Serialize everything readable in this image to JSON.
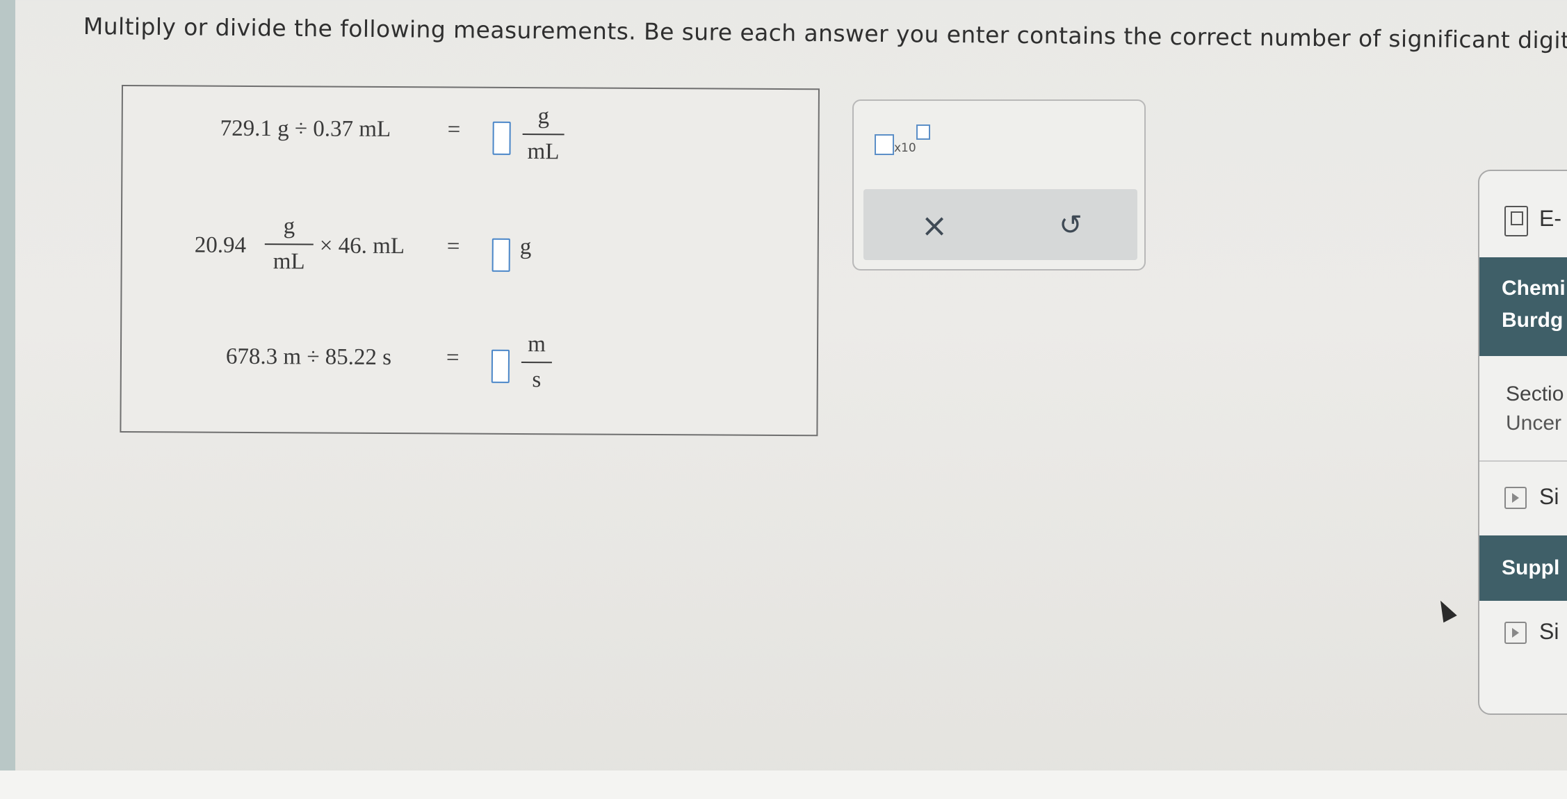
{
  "instructions": "Multiply or divide the following measurements. Be sure each answer you enter contains the correct number of significant digits.",
  "problems": [
    {
      "lhs": "729.1 g ÷ 0.37 mL",
      "equals": "=",
      "unit_num": "g",
      "unit_den": "mL"
    },
    {
      "lhs_value": "20.94",
      "lhs_num": "g",
      "lhs_den": "mL",
      "lhs_rest": "× 46. mL",
      "equals": "=",
      "unit": "g"
    },
    {
      "lhs": "678.3 m ÷ 85.22 s",
      "equals": "=",
      "unit_num": "m",
      "unit_den": "s"
    }
  ],
  "tool_panel": {
    "sci_notation_label": "x10",
    "clear_symbol": "×",
    "undo_symbol": "↺"
  },
  "side_panel": {
    "ebook_label": "E-",
    "book_lines": [
      "Chemi",
      "Burdg"
    ],
    "section_lines": [
      "Sectio",
      "Uncer"
    ],
    "video1_label": "Si",
    "supplement_label": "Suppl",
    "video2_label": "Si"
  },
  "colors": {
    "answer_box_border": "#4a86c8",
    "side_panel_dark": "#3f5f68",
    "left_strip": "#b9c7c6"
  }
}
